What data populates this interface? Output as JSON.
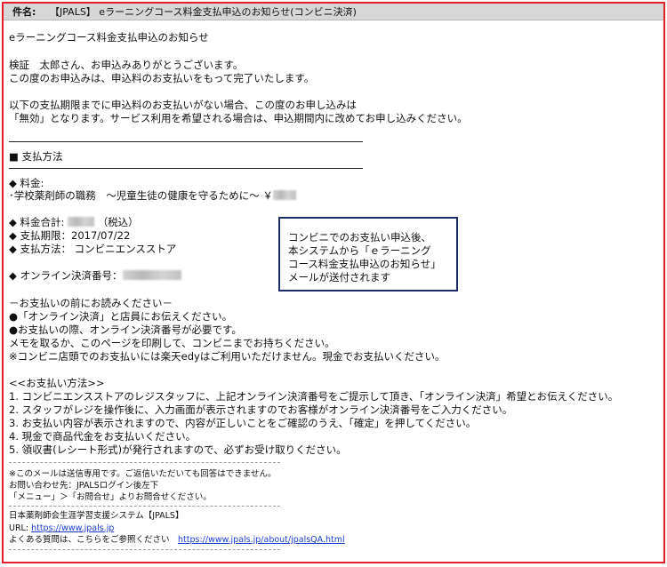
{
  "subject": {
    "label": "件名:",
    "value": "【JPALS】 eラーニングコース料金支払申込のお知らせ(コンビニ決済)"
  },
  "body": {
    "heading": "eラーニングコース料金支払申込のお知らせ",
    "greeting_name": "検証　太郎さん、お申込みありがとうございます。",
    "greeting_line2": "この度のお申込みは、申込料のお支払いをもって完了いたします。",
    "notice_line1": "以下の支払期限までに申込料のお支払いがない場合、この度のお申し込みは",
    "notice_line2": "「無効」となります。サービス利用を希望される場合は、申込期間内に改めてお申し込みください。",
    "section_title": "■ 支払方法",
    "fee_label": "◆ 料金:",
    "fee_item": "･学校薬剤師の職務　～児童生徒の健康を守るために～ ￥",
    "total_label": "◆ 料金合計:",
    "total_suffix": "（税込）",
    "deadline": "◆ 支払期限：2017/07/22",
    "method": "◆ 支払方法：  コンビニエンスストア",
    "online_number_label": "◆ オンライン決済番号：",
    "before_pay_title": "－お支払いの前にお読みください－",
    "before_pay_1": "●「オンライン決済」と店員にお伝えください。",
    "before_pay_2": "●お支払いの際、オンライン決済番号が必要です。",
    "before_pay_3": "メモを取るか、このページを印刷して、コンビニまでお持ちください。",
    "before_pay_4": "※コンビニ店頭でのお支払いには楽天edyはご利用いただけません。現金でお支払いください。",
    "how_title": "<<お支払い方法>>",
    "steps": [
      "1. コンビニエンスストアのレジスタッフに、上記オンライン決済番号をご提示して頂き、「オンライン決済」希望とお伝えください。",
      "2. スタッフがレジを操作後に、入力画面が表示されますのでお客様がオンライン決済番号をご入力ください。",
      "3. お支払い内容が表示されますので、内容が正しいことをご確認のうえ、「確定」を押してください。",
      "4. 現金で商品代金をお支払いください。",
      "5. 領収書(レシート形式)が発行されますので、必ずお受け取りください。"
    ]
  },
  "footer": {
    "note1": "※このメールは送信専用です。ご返信いただいても回答はできません。",
    "note2": "お問い合わせ先：JPALSログイン後左下",
    "note3": "「メニュー」＞「お問合せ」よりお問合せください。",
    "org": "日本薬剤師会生涯学習支援システム【JPALS】",
    "url_label": "URL: ",
    "url": "https://www.jpals.jp",
    "faq_label": "よくある質問は、こちらをご参照ください　",
    "faq_url": "https://www.jpals.jp/about/jpalsQA.html"
  },
  "callout": {
    "line1": "コンビニでのお支払い申込後、",
    "line2": "本システムから「ｅラーニング",
    "line3": "コース料金支払申込のお知らせ」",
    "line4": "メールが送付されます"
  },
  "colors": {
    "frame_border": "#e0202a",
    "callout_border": "#1d2f6a",
    "link": "#1a3fd0"
  }
}
